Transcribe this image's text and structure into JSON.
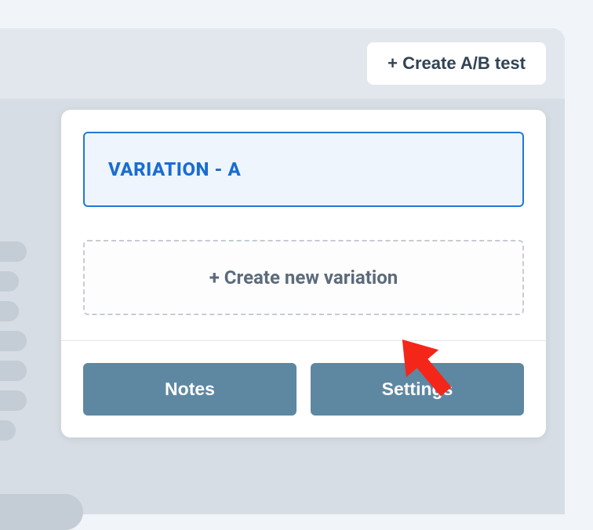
{
  "header": {
    "create_ab_test_label": "+ Create A/B test"
  },
  "panel": {
    "variation_label": "VARIATION - A",
    "create_variation_label": "+ Create new variation",
    "notes_label": "Notes",
    "settings_label": "Settings"
  },
  "colors": {
    "accent_blue": "#1a6dd0",
    "button_blue": "#5e87a2",
    "annotation_red": "#f4261a"
  }
}
